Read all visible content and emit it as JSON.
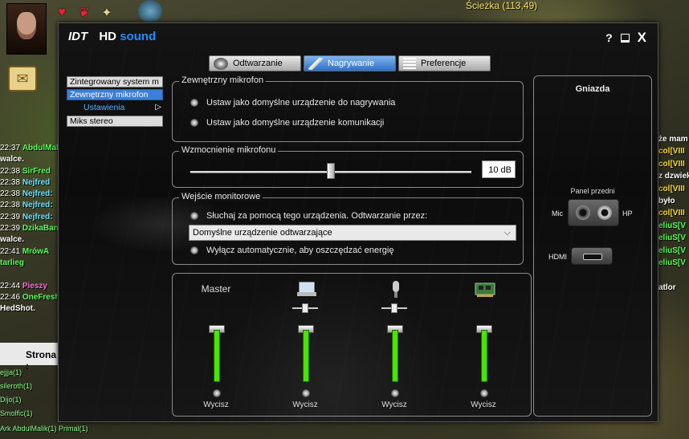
{
  "game": {
    "coords": "Ścieżka (113,49)",
    "chat_left": [
      {
        "time": "22:37",
        "name": "AbdulMali",
        "cls": "g"
      },
      {
        "time": "",
        "name": "walce.",
        "cls": "w"
      },
      {
        "time": "22:38",
        "name": "SirFred",
        "cls": "g"
      },
      {
        "time": "22:38",
        "name": "Nejfred",
        "cls": "n"
      },
      {
        "time": "22:38",
        "name": "Nejfred:",
        "cls": "n"
      },
      {
        "time": "22:38",
        "name": "Nejfred:",
        "cls": "n"
      },
      {
        "time": "22:39",
        "name": "Nejfred:",
        "cls": "n"
      },
      {
        "time": "22:39",
        "name": "DzikaBan",
        "cls": "g"
      },
      {
        "time": "",
        "name": "walce.",
        "cls": "w"
      },
      {
        "time": "22:41",
        "name": "MrówA",
        "cls": "g"
      },
      {
        "time": "",
        "name": "tarlieg",
        "cls": "g"
      },
      {
        "time": "",
        "name": "",
        "cls": "w"
      },
      {
        "time": "22:44",
        "name": "Pieszy",
        "cls": "p"
      },
      {
        "time": "22:46",
        "name": "OneFresh",
        "cls": "g"
      },
      {
        "time": "",
        "name": "HedShot.",
        "cls": "w"
      }
    ],
    "strona_label": "Strona :",
    "online": [
      "ejjja(1)",
      "sileroth(1)",
      "Dijo(1)",
      "Smolfic(1)"
    ],
    "online_bottom": "Ark  AbdulMalik(1)  Primal(1)",
    "chat_right": [
      {
        "text": "że mam",
        "cls": "w"
      },
      {
        "text": "col[VIII",
        "cls": "o"
      },
      {
        "text": "col[VIII",
        "cls": "o"
      },
      {
        "text": "z dzwiek",
        "cls": "w"
      },
      {
        "text": "col[VIII",
        "cls": "o"
      },
      {
        "text": "było",
        "cls": "w"
      },
      {
        "text": "col[VIII",
        "cls": "o"
      },
      {
        "text": "eliuS[V",
        "cls": "g"
      },
      {
        "text": "eliuS[V",
        "cls": "g"
      },
      {
        "text": "eliuS[V",
        "cls": "g"
      },
      {
        "text": "eliuS[V",
        "cls": "g"
      },
      {
        "text": "",
        "cls": "w"
      },
      {
        "text": "atlor",
        "cls": "w"
      }
    ]
  },
  "window": {
    "logo_mark": "IDT",
    "logo_hd": "HD",
    "logo_sound": "sound",
    "help": "?",
    "close": "X"
  },
  "tabs": [
    {
      "label": "Odtwarzanie",
      "icon": "speaker-icon",
      "active": false
    },
    {
      "label": "Nagrywanie",
      "icon": "microphone-icon",
      "active": true
    },
    {
      "label": "Preferencje",
      "icon": "list-icon",
      "active": false
    }
  ],
  "devices": {
    "integrated": "Zintegrowany system m",
    "external": "Zewnętrzny mikrofon",
    "settings": "Ustawienia",
    "stereo": "Miks stereo"
  },
  "external_mic": {
    "title": "Zewnętrzny mikrofon",
    "opt_record": "Ustaw jako domyślne urządzenie do nagrywania",
    "opt_comm": "Ustaw jako domyślne urządzenie komunikacji"
  },
  "gain": {
    "title": "Wzmocnienie mikrofonu",
    "value": "10 dB",
    "level": 0.5
  },
  "monitor": {
    "title": "Wejście monitorowe",
    "listen": "Słuchaj za pomocą tego urządzenia. Odtwarzanie przez:",
    "device": "Domyślne urządzenie odtwarzające",
    "power_save": "Wyłącz automatycznie, aby oszczędzać energię"
  },
  "mixer": [
    {
      "label": "Master",
      "mute": "Wycisz",
      "level": 1.0
    },
    {
      "label": "",
      "icon": "laptop-icon",
      "mute": "Wycisz",
      "level": 1.0
    },
    {
      "label": "",
      "icon": "microphone-icon",
      "mute": "Wycisz",
      "level": 1.0
    },
    {
      "label": "",
      "icon": "sound-card-icon",
      "mute": "Wycisz",
      "level": 1.0
    }
  ],
  "jacks": {
    "title": "Gniazda",
    "panel": "Panel przedni",
    "mic": "Mic",
    "hp": "HP",
    "hdmi": "HDMI"
  }
}
